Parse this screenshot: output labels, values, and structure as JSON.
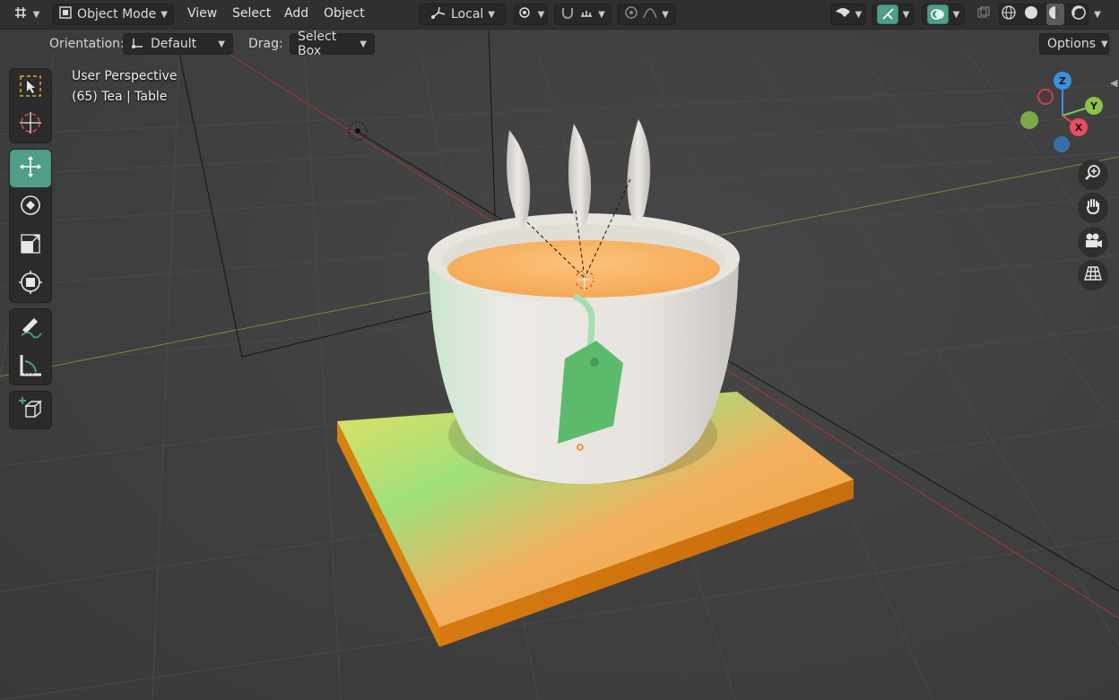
{
  "header": {
    "mode_label": "Object Mode",
    "menu": [
      "View",
      "Select",
      "Add",
      "Object"
    ],
    "transform_orientation_label": "Local",
    "options_label": "Options"
  },
  "tool_settings": {
    "orientation_label": "Orientation:",
    "orientation_value": "Default",
    "drag_label": "Drag:",
    "drag_value": "Select Box"
  },
  "viewport": {
    "view_name": "User Perspective",
    "object_info": "(65) Tea | Table"
  },
  "toolbar": {
    "tools": [
      "select-box",
      "cursor",
      "move",
      "rotate",
      "scale",
      "transform",
      "annotate",
      "measure",
      "add-cube"
    ],
    "active_tool": "move"
  },
  "gizmo": {
    "axes": [
      "Z",
      "Y",
      "X"
    ],
    "colors": {
      "x": "#e84d5f",
      "y": "#8bc34a",
      "z": "#3d8fe0"
    }
  },
  "colors": {
    "accent": "#4e9e8a",
    "tea": "#f8b96a",
    "cup": "#e6e2dc",
    "tag": "#5cba6c",
    "table": "#f0a030"
  },
  "shading_active": "rendered"
}
